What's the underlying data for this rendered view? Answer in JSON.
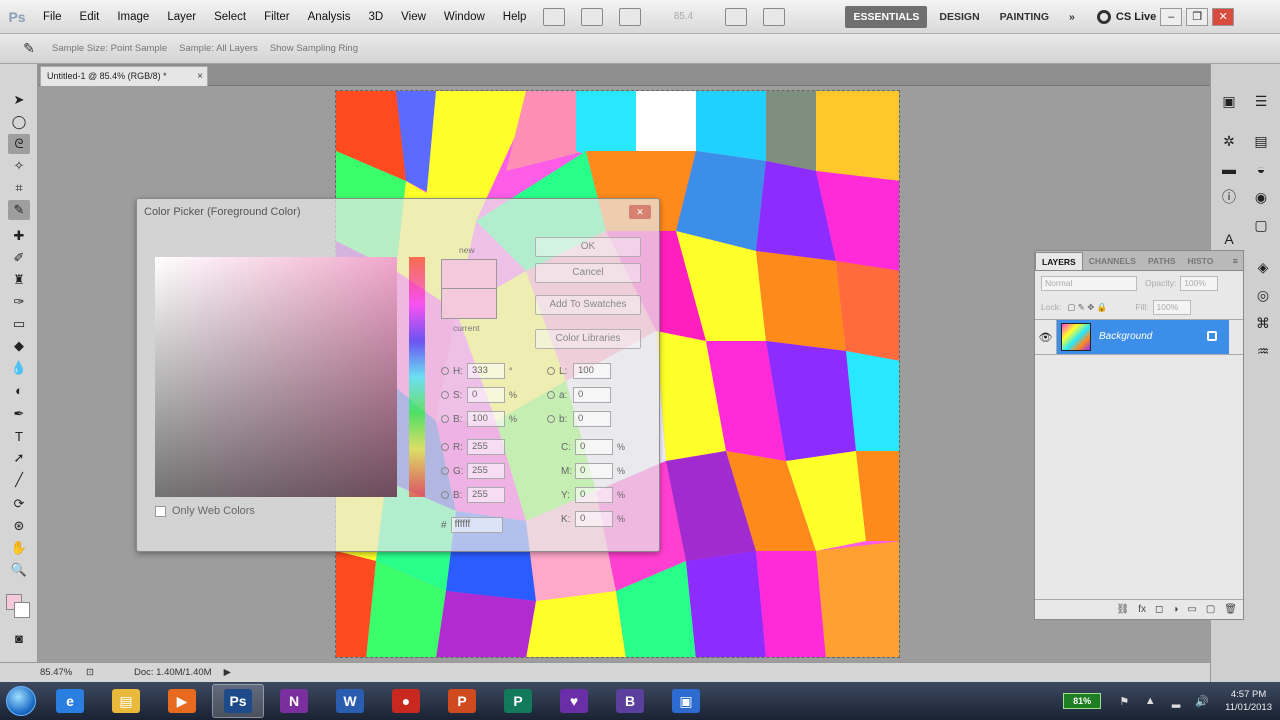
{
  "app": {
    "logo": "Ps",
    "menu": [
      "File",
      "Edit",
      "Image",
      "Layer",
      "Select",
      "Filter",
      "Analysis",
      "3D",
      "View",
      "Window",
      "Help"
    ],
    "zoom_dropdown": "85.4",
    "workspaces": [
      "ESSENTIALS",
      "DESIGN",
      "PAINTING"
    ],
    "more_workspaces": "»",
    "cs_live": "CS Live",
    "window_controls": [
      "–",
      "❐",
      "✕"
    ]
  },
  "options_bar": {
    "tool_icon": "eyedropper-icon",
    "sample_size_label": "Sample Size: Point Sample",
    "sample_label": "Sample: All Layers",
    "show_sampling_ring": "Show Sampling Ring"
  },
  "document": {
    "tab_title": "Untitled-1 @ 85.4% (RGB/8) *",
    "tab_close": "×",
    "zoom": "85.47%",
    "doc_size": "Doc: 1.40M/1.40M"
  },
  "color_picker": {
    "title": "Color Picker (Foreground Color)",
    "new_label": "new",
    "current_label": "current",
    "buttons": [
      "OK",
      "Cancel",
      "Add To Swatches",
      "Color Libraries"
    ],
    "hsb": [
      {
        "label": "H:",
        "value": "333",
        "unit": "°"
      },
      {
        "label": "S:",
        "value": "0",
        "unit": "%"
      },
      {
        "label": "B:",
        "value": "100",
        "unit": "%"
      }
    ],
    "rgb": [
      {
        "label": "R:",
        "value": "255"
      },
      {
        "label": "G:",
        "value": "255"
      },
      {
        "label": "B:",
        "value": "255"
      }
    ],
    "lab": [
      {
        "label": "L:",
        "value": "100"
      },
      {
        "label": "a:",
        "value": "0"
      },
      {
        "label": "b:",
        "value": "0"
      }
    ],
    "cmyk": [
      {
        "label": "C:",
        "value": "0",
        "unit": "%"
      },
      {
        "label": "M:",
        "value": "0",
        "unit": "%"
      },
      {
        "label": "Y:",
        "value": "0",
        "unit": "%"
      },
      {
        "label": "K:",
        "value": "0",
        "unit": "%"
      }
    ],
    "hex_label": "#",
    "hex_value": "ffffff",
    "only_web_colors": "Only Web Colors"
  },
  "layers_panel": {
    "tabs": [
      "LAYERS",
      "CHANNELS",
      "PATHS",
      "HISTO"
    ],
    "menu_icon": "≡",
    "blend_mode": "Normal",
    "opacity_label": "Opacity:",
    "opacity_value": "100%",
    "lock_label": "Lock:",
    "fill_label": "Fill:",
    "fill_value": "100%",
    "layer_name": "Background"
  },
  "taskbar": {
    "battery": "81%",
    "time": "4:57 PM",
    "date": "11/01/2013",
    "apps": [
      {
        "name": "internet-explorer",
        "label": "e",
        "color": "#2a7de1"
      },
      {
        "name": "windows-explorer",
        "label": "▤",
        "color": "#e8b93a"
      },
      {
        "name": "media-player",
        "label": "▶",
        "color": "#e86a1e"
      },
      {
        "name": "photoshop",
        "label": "Ps",
        "color": "#1f4a8a"
      },
      {
        "name": "onenote",
        "label": "N",
        "color": "#7b2f9e"
      },
      {
        "name": "word",
        "label": "W",
        "color": "#2a5db0"
      },
      {
        "name": "app-red",
        "label": "●",
        "color": "#c8281e"
      },
      {
        "name": "powerpoint",
        "label": "P",
        "color": "#d04a1f"
      },
      {
        "name": "publisher",
        "label": "P",
        "color": "#127a5a"
      },
      {
        "name": "app-purple",
        "label": "♥",
        "color": "#6a2ea8"
      },
      {
        "name": "app-violet",
        "label": "B",
        "color": "#5a3f9c"
      },
      {
        "name": "app-blue",
        "label": "▣",
        "color": "#2d6bd0"
      }
    ]
  },
  "colors": {
    "foreground": "#f5c9dc",
    "background": "#ffffff",
    "layer_selection": "#3d8ee8",
    "active_workspace": "#6f6f6f"
  }
}
